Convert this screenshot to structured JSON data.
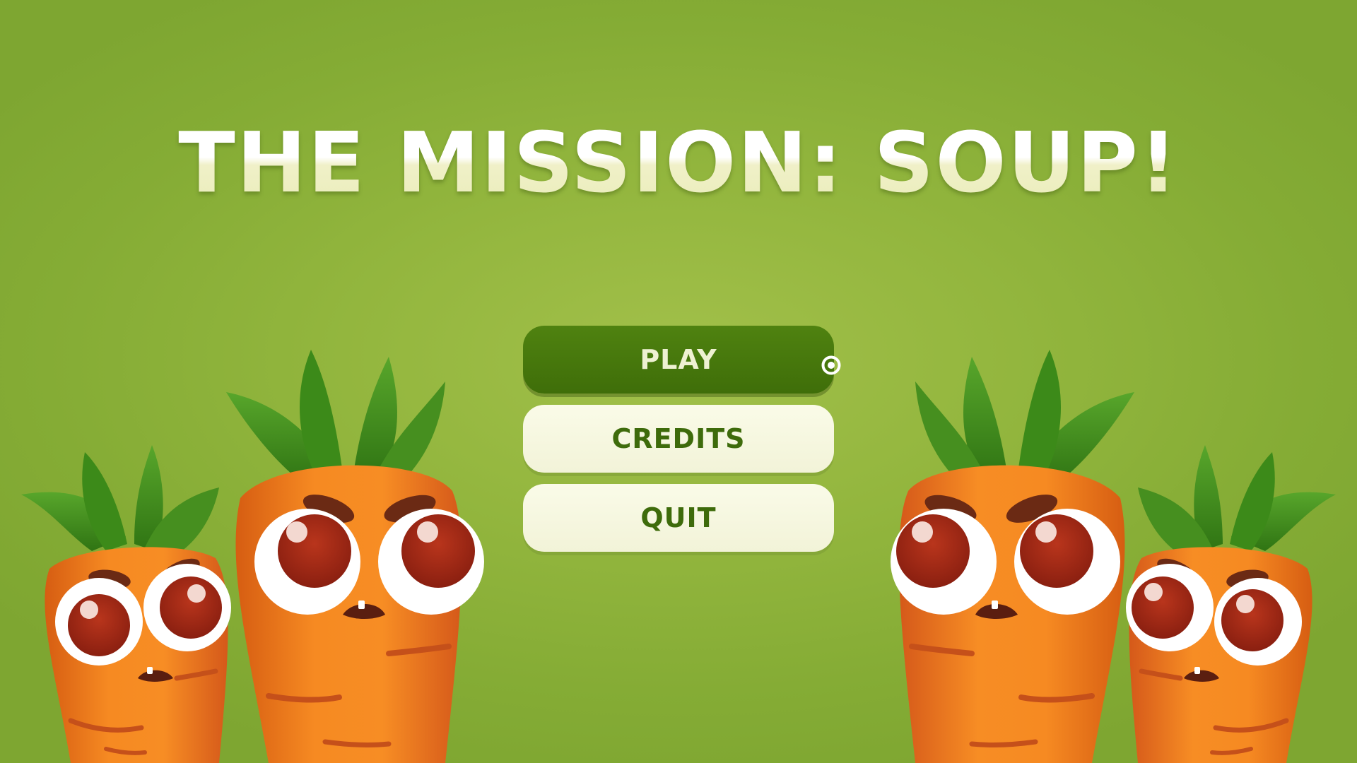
{
  "game": {
    "title": "THE MISSION: SOUP!"
  },
  "menu": {
    "items": [
      {
        "label": "PLAY",
        "selected": true
      },
      {
        "label": "CREDITS",
        "selected": false
      },
      {
        "label": "QUIT",
        "selected": false
      }
    ]
  },
  "colors": {
    "background": "#93b63e",
    "selected_button": "#4a7d0e",
    "button": "#f6f7e0",
    "button_text": "#3e6b0b",
    "title_text": "#f3f4cf",
    "carrot_body": "#f07f1e",
    "carrot_leaves": "#3f8f1a"
  },
  "icons": {
    "cursor": "target-cursor-icon"
  },
  "characters": [
    "carrot",
    "carrot",
    "carrot",
    "carrot"
  ]
}
